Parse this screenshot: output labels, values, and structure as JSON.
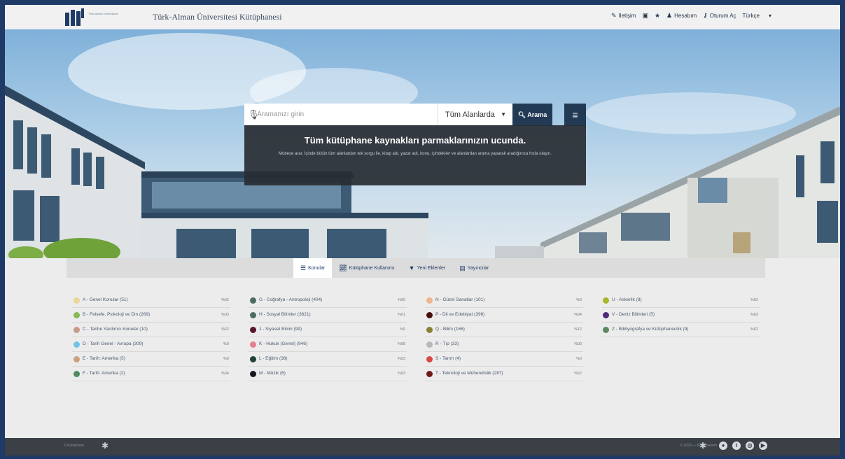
{
  "header": {
    "logo_text": "faü",
    "logo_subtitle": "Türk-Alman Üniversitesi",
    "site_title": "Türk-Alman Üniversitesi Kütüphanesi",
    "nav": [
      {
        "icon": "edit-icon",
        "label": "Iletişim"
      },
      {
        "icon": "briefcase-icon",
        "label": ""
      },
      {
        "icon": "star-icon",
        "label": ""
      },
      {
        "icon": "user-icon",
        "label": "Hesabım"
      },
      {
        "icon": "key-icon",
        "label": "Oturum Aç"
      },
      {
        "icon": "",
        "label": "Türkçe"
      }
    ]
  },
  "search": {
    "placeholder": "Aramanızı girin",
    "scope": "Tüm Alanlarda",
    "button_label": "Arama"
  },
  "tagline": {
    "title": "Tüm kütüphane kaynakları parmaklarınızın ucunda.",
    "text": "Mobese arar. İçinde bütün tüm alanlardan tek sorgu ile, kitap adı, yazar adı, konu, içindekiler ve alanlardan arama yaparak aradığınıza hızla ulaşın."
  },
  "tabs": [
    {
      "icon": "list-icon",
      "label": "Konular",
      "active": true
    },
    {
      "icon": "chart-icon",
      "label": "Kütüphane Kullanımı",
      "active": false
    },
    {
      "icon": "filter-icon",
      "label": "Yeni Eklenler",
      "active": false
    },
    {
      "icon": "book-icon",
      "label": "Yayıncılar",
      "active": false
    }
  ],
  "categories": [
    [
      {
        "label": "A - Genel Konular",
        "count": "(51)",
        "code": "%62",
        "color": "#ecd69a"
      },
      {
        "label": "B - Felsefe, Psikoloji ve Din",
        "count": "(269)",
        "code": "%03",
        "color": "#86b955"
      },
      {
        "label": "C - Tarihe Yardımcı Konular",
        "count": "(10)",
        "code": "%62",
        "color": "#c99a8a"
      },
      {
        "label": "D - Tarih Genel - Avrupa",
        "count": "(309)",
        "code": "%0",
        "color": "#6fc4e6"
      },
      {
        "label": "E - Tarih: Amerika",
        "count": "(5)",
        "code": "%0",
        "color": "#c7a27a"
      },
      {
        "label": "F - Tarih: Amerika",
        "count": "(2)",
        "code": "%04",
        "color": "#4f8a5e"
      }
    ],
    [
      {
        "label": "G - Coğrafya - Antropoloji",
        "count": "(404)",
        "code": "%00",
        "color": "#4d6c61"
      },
      {
        "label": "H - Sosyal Bilimler",
        "count": "(3621)",
        "code": "%01",
        "color": "#4d6c61"
      },
      {
        "label": "J - Siyaset Bilimi",
        "count": "(99)",
        "code": "%0",
        "color": "#5a1628"
      },
      {
        "label": "K - Hukuk (Genel)",
        "count": "(946)",
        "code": "%68",
        "color": "#e67f8d"
      },
      {
        "label": "L - Eğitim",
        "count": "(38)",
        "code": "%03",
        "color": "#244232"
      },
      {
        "label": "M - Müzik",
        "count": "(6)",
        "code": "%03",
        "color": "#16181f"
      }
    ],
    [
      {
        "label": "N - Güzel Sanatlar",
        "count": "(101)",
        "code": "%0",
        "color": "#f2b48c"
      },
      {
        "label": "P - Dil ve Edebiyat",
        "count": "(396)",
        "code": "%04",
        "color": "#4b0e10"
      },
      {
        "label": "Q - Bilim",
        "count": "(166)",
        "code": "%12",
        "color": "#8a8131"
      },
      {
        "label": "R - Tıp",
        "count": "(33)",
        "code": "%03",
        "color": "#b9b9b9"
      },
      {
        "label": "S - Tarım",
        "count": "(4)",
        "code": "%0",
        "color": "#d64a43"
      },
      {
        "label": "T - Teknoloji ve Mühendislik",
        "count": "(287)",
        "code": "%62",
        "color": "#6e1a19"
      }
    ],
    [
      {
        "label": "U - Askerlik",
        "count": "(8)",
        "code": "%62",
        "color": "#a9b628"
      },
      {
        "label": "V - Deniz Bilimleri",
        "count": "(5)",
        "code": "%03",
        "color": "#4a2a7a"
      },
      {
        "label": "Z - Bibliyografya ve Kütüphanecilik",
        "count": "(9)",
        "code": "%62",
        "color": "#5c8a60"
      }
    ]
  ],
  "footer": {
    "left_text": "© Kütüphane",
    "right_text": "© 2023 — Kütüphanem",
    "social": [
      {
        "icon": "github-icon",
        "glyph": "●"
      },
      {
        "icon": "twitter-icon",
        "glyph": "t"
      },
      {
        "icon": "instagram-icon",
        "glyph": "◎"
      },
      {
        "icon": "youtube-icon",
        "glyph": "▶"
      }
    ]
  }
}
